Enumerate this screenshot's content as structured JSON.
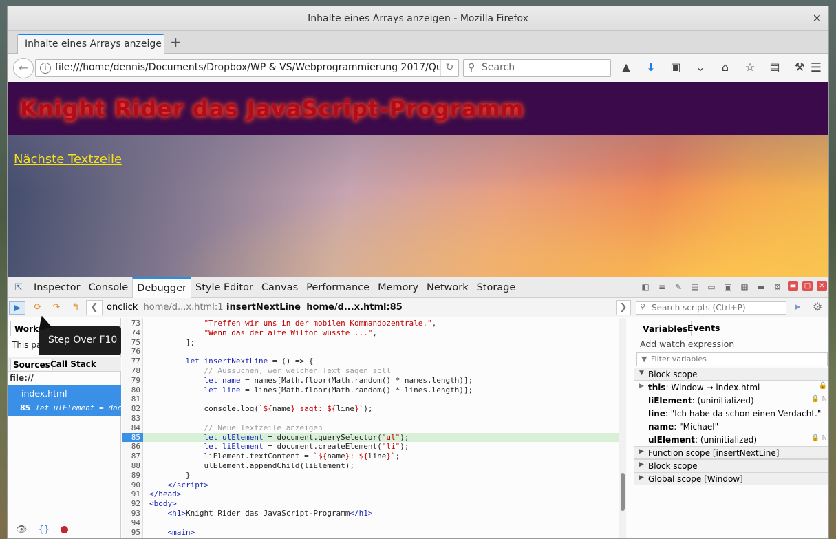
{
  "window": {
    "title": "Inhalte eines Arrays anzeigen - Mozilla Firefox",
    "close_glyph": "✕"
  },
  "tab": {
    "label": "Inhalte eines Arrays anzeige",
    "new_tab_glyph": "+"
  },
  "nav": {
    "url": "file:///home/dennis/Documents/Dropbox/WP & VS/Webprogrammierung 2017/Que",
    "search_placeholder": "Search",
    "icons": [
      "identity-icon",
      "download-icon",
      "screenshot-icon",
      "pocket-icon",
      "home-icon",
      "bookmark-star-icon",
      "reader-icon",
      "devtools-icon"
    ]
  },
  "page": {
    "heading": "Knight Rider das JavaScript-Programm",
    "link": "Nächste Textzeile"
  },
  "devtools": {
    "tabs": [
      "Inspector",
      "Console",
      "Debugger",
      "Style Editor",
      "Canvas",
      "Performance",
      "Memory",
      "Network",
      "Storage"
    ],
    "active_tab": "Debugger"
  },
  "debugger": {
    "breadcrumb1_fn": "onclick",
    "breadcrumb1_loc": "home/d...x.html:1",
    "breadcrumb2_fn": "insertNextLine",
    "breadcrumb2_loc": "home/d...x.html:85",
    "search_placeholder": "Search scripts (Ctrl+P)",
    "tooltip": "Step Over F10",
    "left": {
      "workers_tab": "Work",
      "page_note": "This pag",
      "sources_tab": "Sources",
      "callstack_tab": "Call Stack",
      "root": "file://",
      "file": "index.html",
      "bp_line": "85",
      "bp_code": "let ulElement = doc…"
    },
    "code_lines": [
      {
        "n": "73",
        "html": "            <span class=\"st\">\"Treffen wir uns in der mobilen Kommandozentrale.\"</span>,"
      },
      {
        "n": "74",
        "html": "            <span class=\"st\">\"Wenn das der alte Wilton wüsste ...\"</span>,"
      },
      {
        "n": "75",
        "html": "        ];"
      },
      {
        "n": "76",
        "html": ""
      },
      {
        "n": "77",
        "html": "        <span class=\"kw\">let</span> <span class=\"vr\">insertNextLine</span> = () =&gt; {"
      },
      {
        "n": "78",
        "html": "            <span class=\"cm\">// Aussuchen, wer welchen Text sagen soll</span>"
      },
      {
        "n": "79",
        "html": "            <span class=\"kw\">let</span> <span class=\"vr\">name</span> = names[Math.floor(Math.random() * names.length)];"
      },
      {
        "n": "80",
        "html": "            <span class=\"kw\">let</span> <span class=\"vr\">line</span> = lines[Math.floor(Math.random() * lines.length)];"
      },
      {
        "n": "81",
        "html": ""
      },
      {
        "n": "82",
        "html": "            console.log(<span class=\"st\">`${</span>name<span class=\"st\">} sagt: ${</span>line<span class=\"st\">}`</span>);"
      },
      {
        "n": "83",
        "html": ""
      },
      {
        "n": "84",
        "html": "            <span class=\"cm\">// Neue Textzeile anzeigen</span>"
      },
      {
        "n": "85",
        "html": "            <span class=\"kw\">let</span> <span class=\"vr\">ulElement</span> = document.querySelector(<span class=\"st\">\"ul\"</span>);",
        "paused": true
      },
      {
        "n": "86",
        "html": "            <span class=\"kw\">let</span> <span class=\"vr\">liElement</span> = document.createElement(<span class=\"st\">\"li\"</span>);"
      },
      {
        "n": "87",
        "html": "            liElement.textContent = <span class=\"st\">`${</span>name<span class=\"st\">}: ${</span>line<span class=\"st\">}`</span>;"
      },
      {
        "n": "88",
        "html": "            ulElement.appendChild(liElement);"
      },
      {
        "n": "89",
        "html": "        }"
      },
      {
        "n": "90",
        "html": "    <span class=\"tg\">&lt;/script&gt;</span>"
      },
      {
        "n": "91",
        "html": "<span class=\"tg\">&lt;/head&gt;</span>"
      },
      {
        "n": "92",
        "html": "<span class=\"tg\">&lt;body&gt;</span>"
      },
      {
        "n": "93",
        "html": "    <span class=\"tg\">&lt;h1&gt;</span>Knight Rider das JavaScript-Programm<span class=\"tg\">&lt;/h1&gt;</span>"
      },
      {
        "n": "94",
        "html": ""
      },
      {
        "n": "95",
        "html": "    <span class=\"tg\">&lt;main&gt;</span>"
      }
    ],
    "right": {
      "tab_variables": "Variables",
      "tab_events": "Events",
      "watch": "Add watch expression",
      "filter": "Filter variables",
      "scopes": [
        {
          "name": "Block scope",
          "open": true,
          "vars": [
            {
              "key": "this",
              "val": ": Window → index.html",
              "lock": "🔒",
              "expandable": true
            },
            {
              "key": "liElement",
              "val": ": (uninitialized)",
              "lock": "🔒 N"
            },
            {
              "key": "line",
              "val": ": \"Ich habe da schon einen Verdacht.\""
            },
            {
              "key": "name",
              "val": ": \"Michael\""
            },
            {
              "key": "ulElement",
              "val": ": (uninitialized)",
              "lock": "🔒 N"
            }
          ]
        },
        {
          "name": "Function scope [insertNextLine]",
          "open": false,
          "vars": []
        },
        {
          "name": "Block scope",
          "open": false,
          "vars": []
        },
        {
          "name": "Global scope [Window]",
          "open": false,
          "vars": []
        }
      ]
    }
  }
}
